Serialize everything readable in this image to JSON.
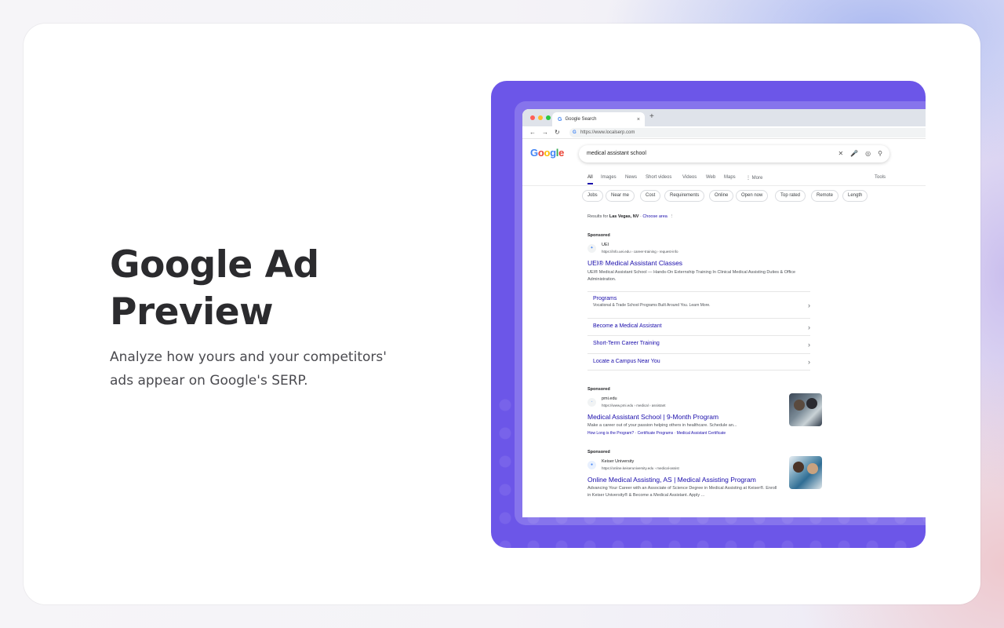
{
  "hero": {
    "title": "Google Ad Preview",
    "subtitle": "Analyze how yours and your competitors' ads appear on Google's SERP."
  },
  "browser": {
    "tab_title": "Google Search",
    "url": "https://www.localserp.com",
    "tab_favicon": "G"
  },
  "serp": {
    "logo": [
      "G",
      "o",
      "o",
      "g",
      "l",
      "e"
    ],
    "query": "medical assistant school",
    "filters": [
      "All",
      "Images",
      "News",
      "Short videos",
      "Videos",
      "Web",
      "Maps",
      "⋮ More",
      "Tools"
    ],
    "chips": [
      "Jobs",
      "Near me",
      "Cost",
      "Requirements",
      "Online",
      "Open now",
      "Top rated",
      "Remote",
      "Length"
    ],
    "results_for_prefix": "Results for",
    "location": "Las Vegas, NV",
    "choose_area": "Choose area",
    "ads": [
      {
        "sponsored": "Sponsored",
        "site": "UEI",
        "url": "https://info.uei.edu › career-training › request-info",
        "title": "UEI® Medical Assistant Classes",
        "desc": "UEI® Medical Assistant School — Hands-On Externship Training In Clinical Medical Assisting Duties & Office Administration.",
        "sitelinks": [
          {
            "title": "Programs",
            "sub": "Vocational & Trade School Programs Built Around You. Learn More."
          },
          {
            "title": "Become a Medical Assistant",
            "sub": ""
          },
          {
            "title": "Short-Term Career Training",
            "sub": ""
          },
          {
            "title": "Locate a Campus Near You",
            "sub": ""
          }
        ]
      },
      {
        "sponsored": "Sponsored",
        "site": "pmi.edu",
        "url": "https://www.pmi.edu › medical › assistant",
        "title": "Medical Assistant School | 9-Month Program",
        "desc": "Make a career out of your passion helping others in healthcare. Schedule an...",
        "inline_links": "How Long is the Program? · Certificate Programs · Medical Assistant Certificate"
      },
      {
        "sponsored": "Sponsored",
        "site": "Keiser University",
        "url": "https://online.keiseruniversity.edu › medical-assist",
        "title": "Online Medical Assisting, AS | Medical Assisting Program",
        "desc": "Advancing Your Career with an Associate of Science Degree in Medical Assisting at Keiser®. Enroll in Keiser University® & Become a Medical Assistant. Apply ..."
      }
    ]
  },
  "colors": {
    "accent_purple": "#6c56e8",
    "link_blue": "#1a0dab"
  }
}
